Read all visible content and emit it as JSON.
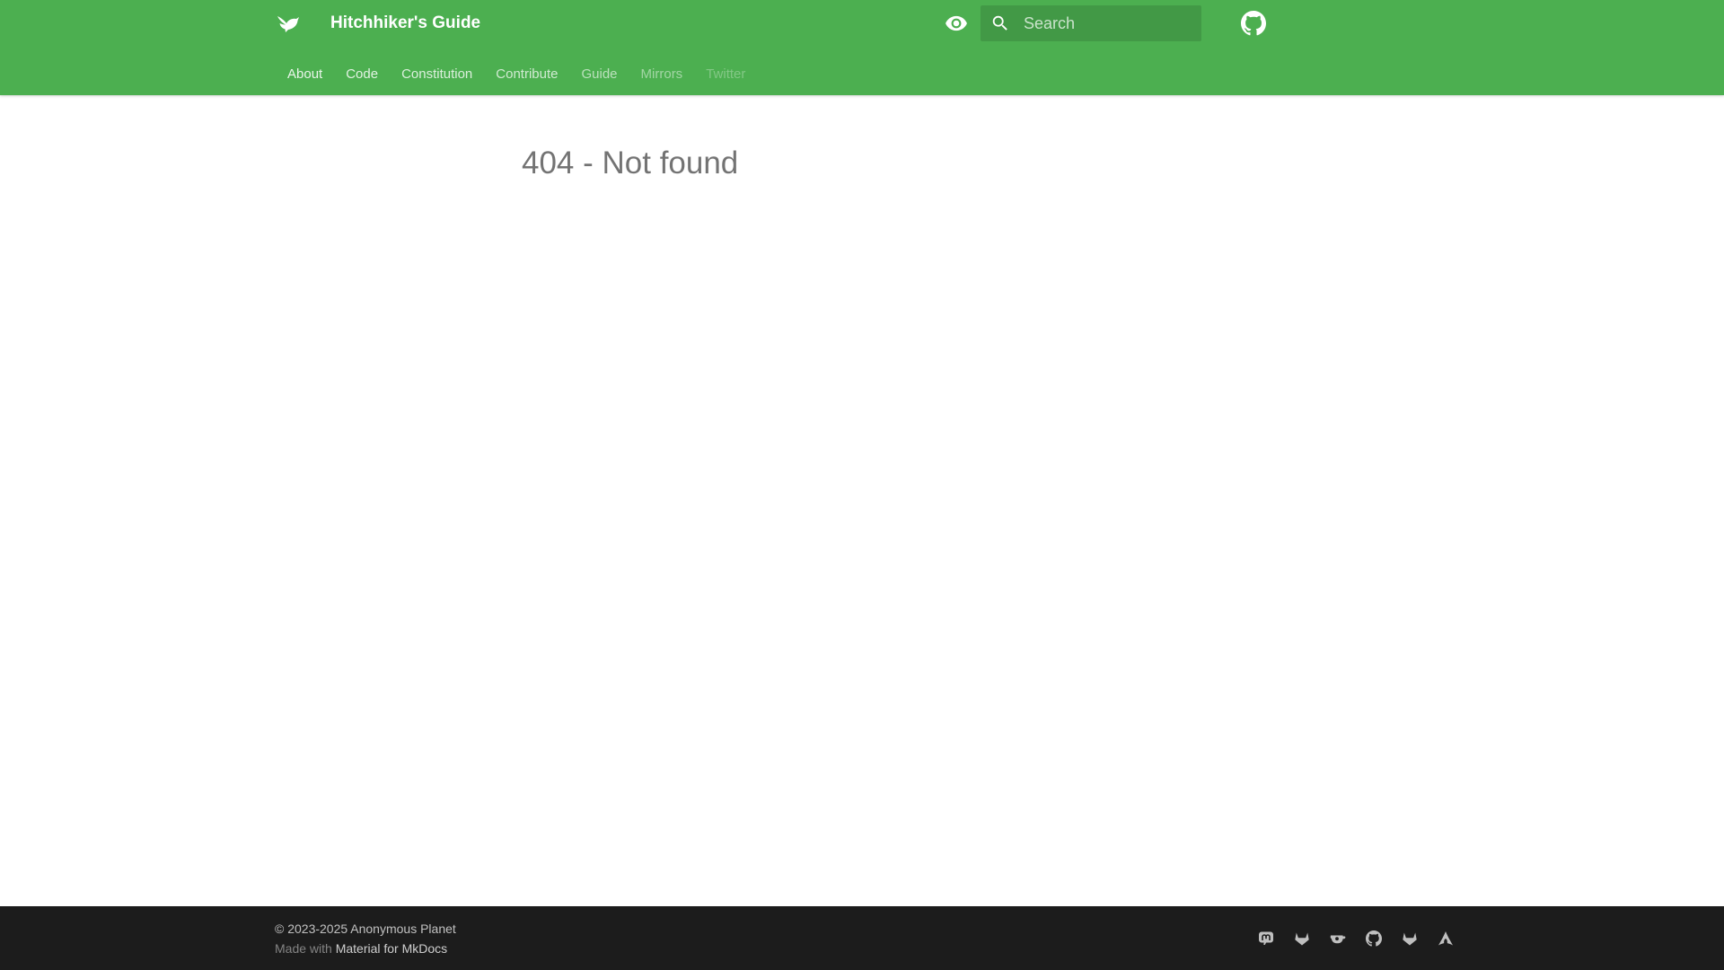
{
  "header": {
    "title": "Hitchhiker's Guide",
    "logo_icon": "bird-icon",
    "palette_icon": "eye-icon",
    "repo_icon": "github-icon",
    "background_color": "#4caf50"
  },
  "search": {
    "placeholder": "Search",
    "value": "",
    "icon": "search-icon"
  },
  "tabs": [
    {
      "label": "About"
    },
    {
      "label": "Code"
    },
    {
      "label": "Constitution"
    },
    {
      "label": "Contribute"
    },
    {
      "label": "Guide"
    },
    {
      "label": "Mirrors"
    },
    {
      "label": "Twitter"
    }
  ],
  "main": {
    "title": "404 - Not found"
  },
  "footer": {
    "copyright": "© 2023-2025 Anonymous Planet",
    "made_with_prefix": "Made with",
    "made_with_link": "Material for MkDocs",
    "background_color": "#1c1c1c",
    "social_icons": [
      "mastodon-icon",
      "gitlab-icon",
      "gitea-icon",
      "github-icon",
      "gitlab-icon",
      "arch-icon"
    ]
  }
}
